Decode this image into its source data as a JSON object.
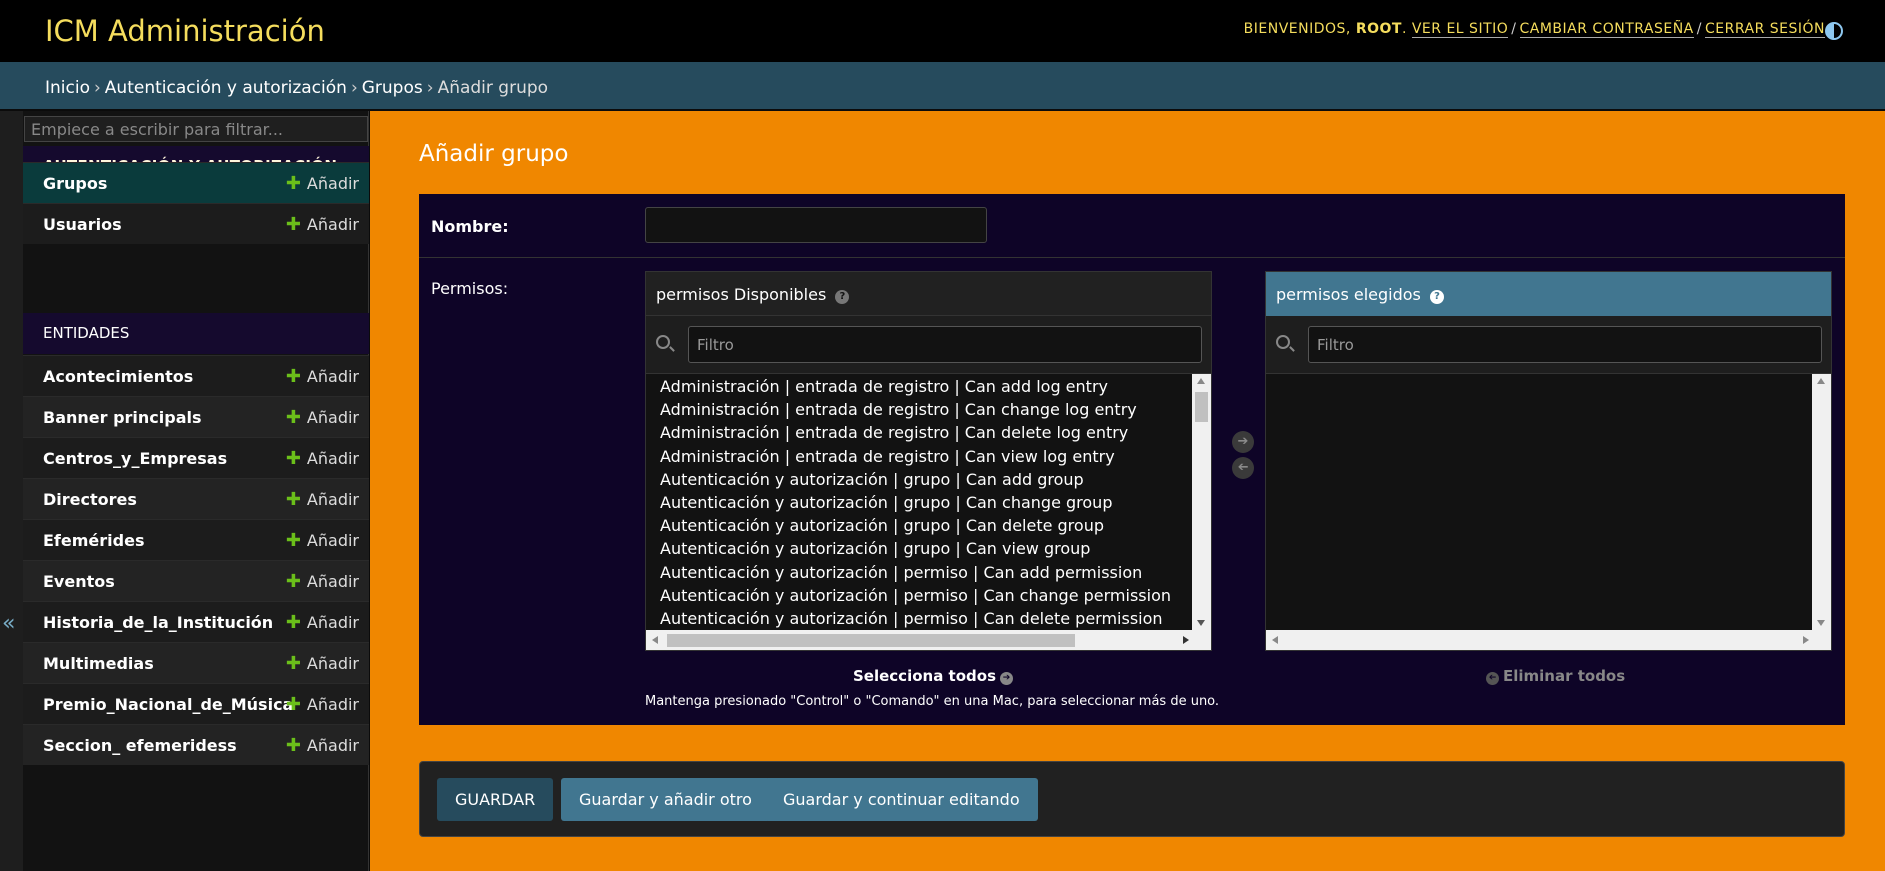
{
  "header": {
    "branding": "ICM Administración",
    "welcome": "BIENVENIDOS,",
    "user": "ROOT",
    "links": [
      "VER EL SITIO",
      "CAMBIAR CONTRASEÑA",
      "CERRAR SESIÓN"
    ],
    "separator": "/"
  },
  "breadcrumbs": {
    "items": [
      "Inicio",
      "Autenticación y autorización",
      "Grupos",
      "Añadir grupo"
    ],
    "separator": "›"
  },
  "sidebar": {
    "filter_placeholder": "Empiece a escribir para filtrar...",
    "collapse_glyph": "«",
    "add_label": "Añadir",
    "apps": [
      {
        "caption": "AUTENTICACIÓN Y AUTORIZACIÓN",
        "models": [
          "Grupos",
          "Usuarios"
        ]
      },
      {
        "caption": "ENTIDADES",
        "models": [
          "Acontecimientos",
          "Banner principals",
          "Centros_y_Empresas",
          "Directores",
          "Efemérides",
          "Eventos",
          "Historia_de_la_Institución",
          "Multimedias",
          "Premio_Nacional_de_Música",
          "Seccion_ efemeridess"
        ]
      }
    ]
  },
  "content": {
    "title": "Añadir grupo",
    "name_label": "Nombre:",
    "name_value": "",
    "permissions_label": "Permisos:",
    "available_title": "permisos Disponibles",
    "chosen_title": "permisos elegidos",
    "help_glyph": "?",
    "filter_placeholder": "Filtro",
    "available_options": [
      "Administración | entrada de registro | Can add log entry",
      "Administración | entrada de registro | Can change log entry",
      "Administración | entrada de registro | Can delete log entry",
      "Administración | entrada de registro | Can view log entry",
      "Autenticación y autorización | grupo | Can add group",
      "Autenticación y autorización | grupo | Can change group",
      "Autenticación y autorización | grupo | Can delete group",
      "Autenticación y autorización | grupo | Can view group",
      "Autenticación y autorización | permiso | Can add permission",
      "Autenticación y autorización | permiso | Can change permission",
      "Autenticación y autorización | permiso | Can delete permission"
    ],
    "chosen_options": [],
    "choose_all": "Selecciona todos",
    "remove_all": "Eliminar todos",
    "help_text": "Mantenga presionado \"Control\" o \"Comando\" en una Mac, para seleccionar más de uno."
  },
  "submit": {
    "save": "GUARDAR",
    "save_add": "Guardar y añadir otro",
    "save_continue": "Guardar y continuar editando"
  },
  "colors": {
    "header_bg": "#000000",
    "branding": "#f5dd5d",
    "breadcrumb_bg": "#264b5d",
    "content_bg": "#f08700",
    "form_bg": "#0e0427",
    "chosen_header": "#417690",
    "add_plus": "#6bbf1a",
    "current_row": "#0a3b3c"
  },
  "icons": {
    "add": "plus-icon",
    "search": "search-icon",
    "help": "help-icon",
    "add_arrow": "arrow-right-circle-icon",
    "remove_arrow": "arrow-left-circle-icon",
    "theme": "theme-toggle-icon",
    "collapse": "collapse-sidebar-icon"
  }
}
